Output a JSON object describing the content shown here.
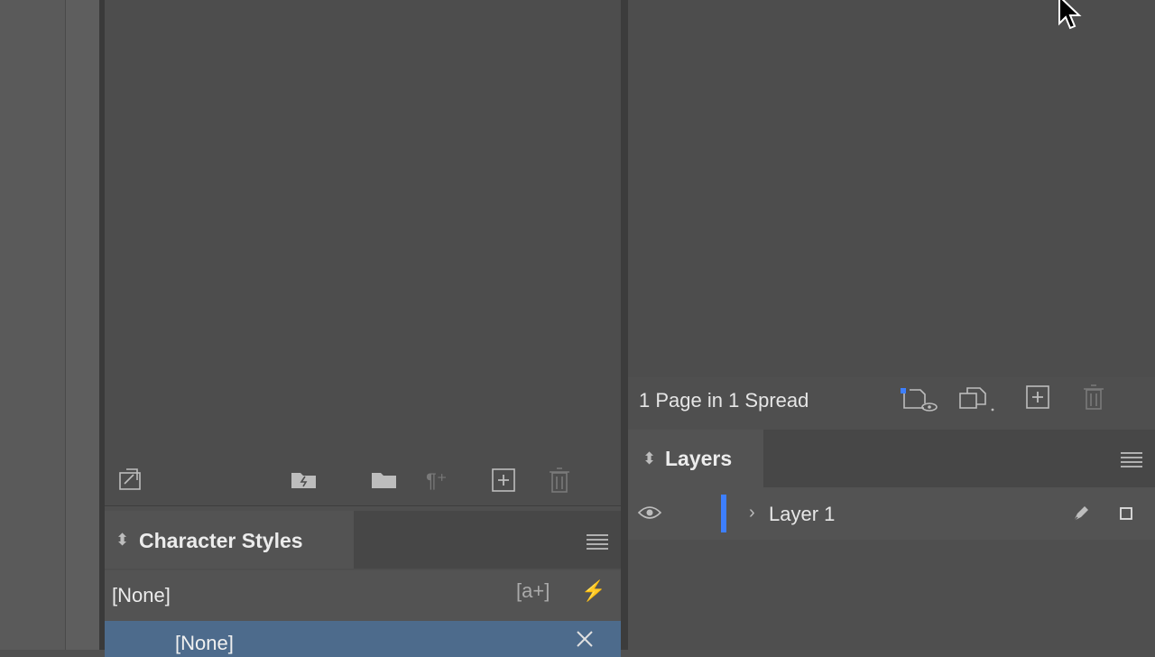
{
  "left_panel": {
    "toolbar_icons": [
      "place-frame-icon",
      "new-style-group-icon",
      "folder-icon",
      "clear-overrides-icon",
      "new-style-icon",
      "trash-icon"
    ],
    "character_styles": {
      "tab_title": "Character Styles",
      "rows": [
        {
          "label": "[None]",
          "buttons": [
            "[a+]",
            "⚡"
          ]
        },
        {
          "label": "[None]",
          "selected": true
        }
      ]
    }
  },
  "right_panel": {
    "pages": {
      "summary": "1 Page in 1 Spread",
      "footer_icons": [
        "edit-page-size-icon",
        "new-master-icon",
        "new-page-icon",
        "delete-page-icon"
      ]
    },
    "layers": {
      "tab_title": "Layers",
      "items": [
        {
          "name": "Layer 1",
          "visible": true,
          "color": "#3d7fff"
        }
      ]
    }
  },
  "colors": {
    "selection": "#4d6b8c",
    "layer_color": "#3d7fff",
    "panel_bg": "#4f4f4f"
  }
}
